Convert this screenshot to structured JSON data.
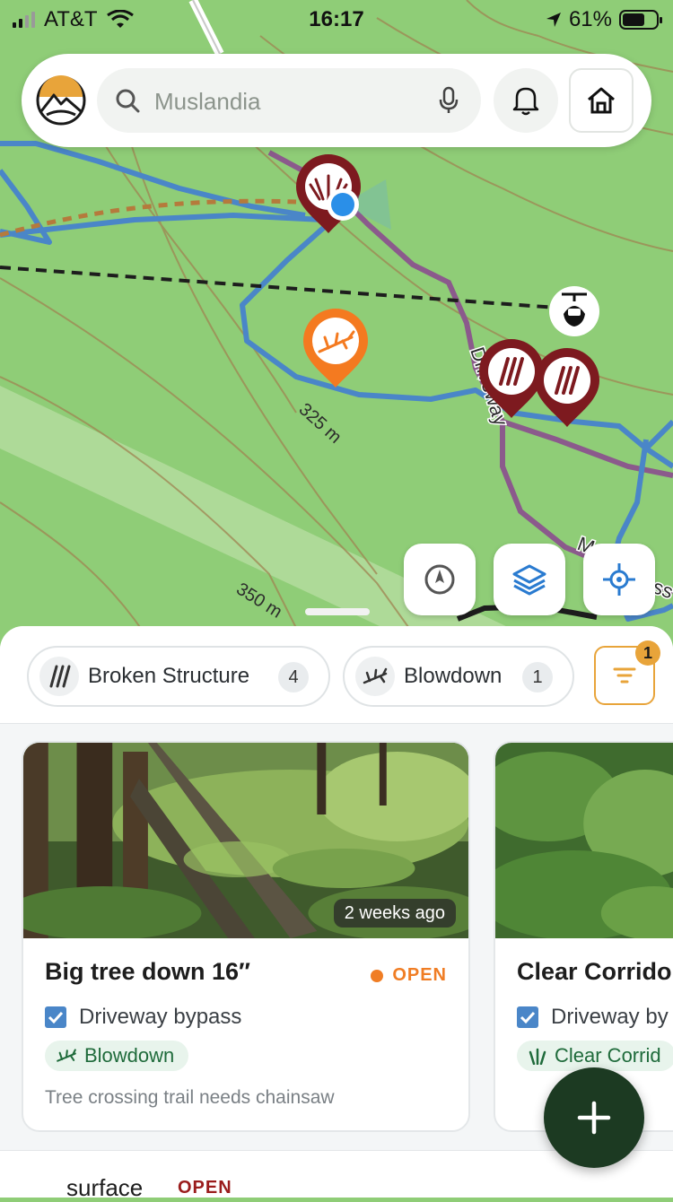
{
  "status_bar": {
    "carrier": "AT&T",
    "time": "16:17",
    "battery": "61%"
  },
  "search": {
    "placeholder": "Muslandia"
  },
  "map": {
    "labels": {
      "trail_driveway": "Driveway",
      "contour_325": "325 m",
      "contour_350": "350 m",
      "trail_partial": "M",
      "trail_partial_2": "ss"
    },
    "colors": {
      "land": "#8fcd77",
      "trail": "#4a86c8",
      "road": "#8b5a8c",
      "marker_dark": "#7d1a1f",
      "marker_orange": "#f47a20"
    }
  },
  "filters": {
    "chips": [
      {
        "label": "Broken Structure",
        "count": "4",
        "icon": "broken-structure-icon"
      },
      {
        "label": "Blowdown",
        "count": "1",
        "icon": "blowdown-icon"
      }
    ],
    "active_count": "1"
  },
  "cards": [
    {
      "time_ago": "2 weeks ago",
      "title": "Big tree down 16″",
      "status": "OPEN",
      "trail": "Driveway bypass",
      "category": "Blowdown",
      "description": "Tree crossing trail needs chainsaw"
    },
    {
      "title": "Clear Corrido",
      "trail": "Driveway by",
      "category": "Clear Corrid"
    }
  ],
  "next_item": {
    "label": "surface",
    "status": "OPEN"
  }
}
